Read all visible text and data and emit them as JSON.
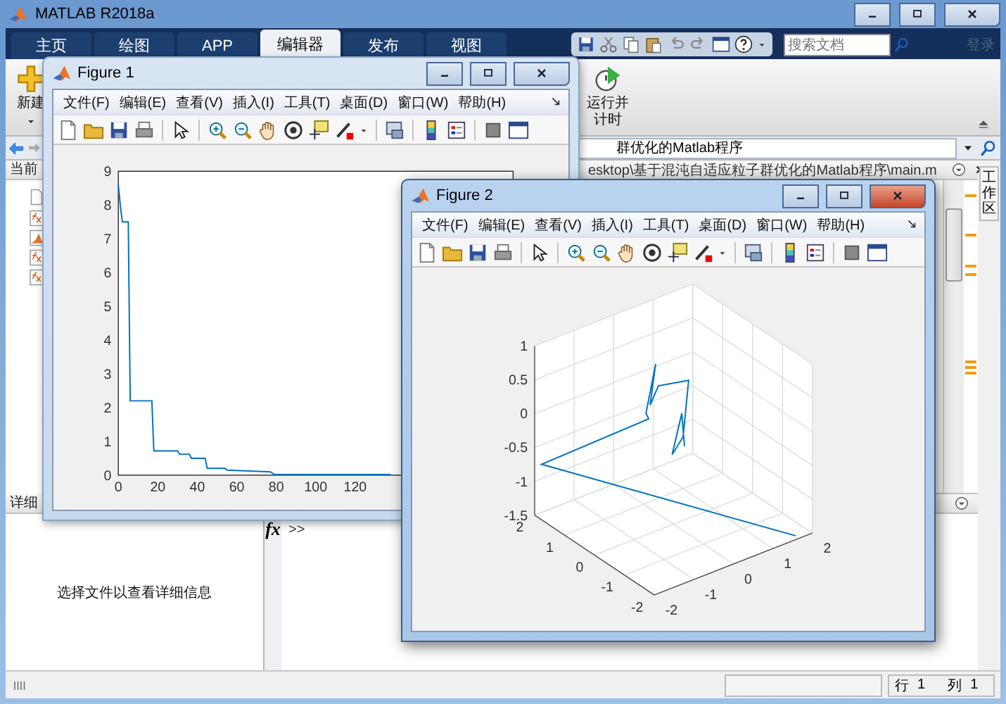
{
  "window": {
    "title": "MATLAB R2018a"
  },
  "tabs": [
    {
      "label": "主页",
      "selected": false
    },
    {
      "label": "绘图",
      "selected": false
    },
    {
      "label": "APP",
      "selected": false
    },
    {
      "label": "编辑器",
      "selected": true
    },
    {
      "label": "发布",
      "selected": false
    },
    {
      "label": "视图",
      "selected": false
    }
  ],
  "search": {
    "placeholder": "搜索文档"
  },
  "login": {
    "label": "登录",
    "disabled": true
  },
  "ribbon": {
    "buttons": [
      {
        "label": "新建",
        "kind": "new"
      },
      {
        "label": "运行并计时",
        "kind": "run"
      }
    ]
  },
  "address": {
    "path": "群优化的Matlab程序"
  },
  "current_folder": {
    "title": "当前"
  },
  "details": {
    "title": "详细",
    "message": "选择文件以查看详细信息"
  },
  "editor": {
    "path": "esktop\\基于混沌自适应粒子群优化的Matlab程序\\main.m"
  },
  "command_window": {
    "function_button": "fx",
    "prompt": ">>"
  },
  "workspace_tab": {
    "label": "工作区"
  },
  "status_bar": {
    "row_label": "行",
    "row": "1",
    "col_label": "列",
    "col": "1"
  },
  "figures": [
    {
      "title": "Figure 1",
      "active": false,
      "menu": [
        "文件(F)",
        "编辑(E)",
        "查看(V)",
        "插入(I)",
        "工具(T)",
        "桌面(D)",
        "窗口(W)",
        "帮助(H)"
      ],
      "chart_data": {
        "type": "line",
        "x": [
          0,
          1,
          2,
          5,
          6,
          17,
          18,
          30,
          31,
          36,
          37,
          44,
          45,
          54,
          55,
          77,
          79,
          138
        ],
        "values": [
          8.6,
          8,
          7.5,
          7.5,
          2.2,
          2.2,
          0.72,
          0.72,
          0.62,
          0.62,
          0.5,
          0.5,
          0.2,
          0.2,
          0.15,
          0.1,
          0.02,
          0.02
        ],
        "xlim": [
          0,
          200
        ],
        "ylim": [
          0,
          9
        ],
        "xticks": [
          0,
          20,
          40,
          60,
          80,
          100,
          120
        ],
        "yticks": [
          0,
          1,
          2,
          3,
          4,
          5,
          6,
          7,
          8,
          9
        ]
      }
    },
    {
      "title": "Figure 2",
      "active": true,
      "menu": [
        "文件(F)",
        "编辑(E)",
        "查看(V)",
        "插入(I)",
        "工具(T)",
        "桌面(D)",
        "窗口(W)",
        "帮助(H)"
      ],
      "plot3d": {
        "z_ticks": [
          "1",
          "0.5",
          "0",
          "-0.5",
          "-1",
          "-1.5"
        ],
        "y_ticks": [
          "2",
          "1",
          "0",
          "-1",
          "-2"
        ],
        "x_ticks": [
          "-2",
          "-1",
          "0",
          "1",
          "2"
        ]
      }
    }
  ]
}
